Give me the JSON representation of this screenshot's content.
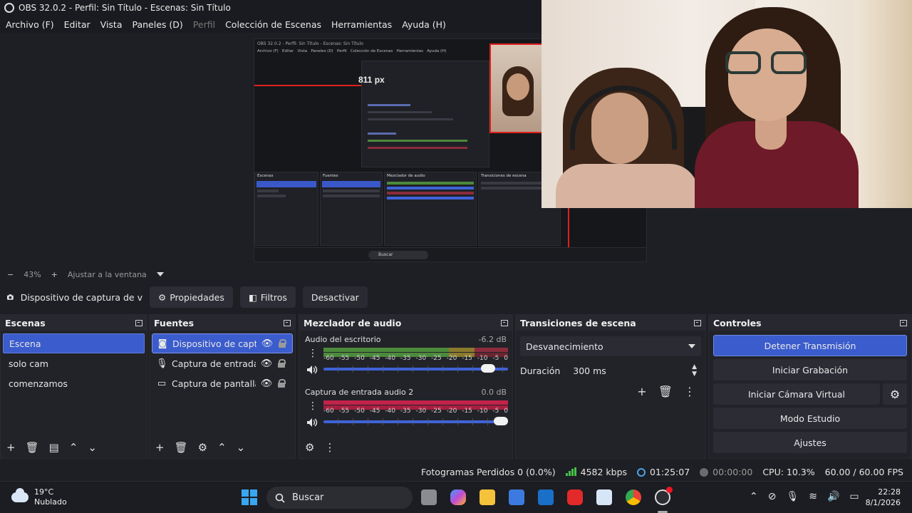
{
  "window": {
    "title": "OBS 32.0.2 - Perfil: Sin Título - Escenas: Sin Título"
  },
  "menu": [
    "Archivo (F)",
    "Editar",
    "Vista",
    "Paneles (D)",
    "Perfil",
    "Colección de Escenas",
    "Herramientas",
    "Ayuda (H)"
  ],
  "preview": {
    "nested_measure": "811 px",
    "nested_search": "Buscar"
  },
  "zoom": {
    "minus": "−",
    "level": "43%",
    "plus": "+",
    "fit": "Ajustar a la ventana"
  },
  "context": {
    "source": "Dispositivo de captura de v",
    "properties": "Propiedades",
    "filters": "Filtros",
    "deactivate": "Desactivar"
  },
  "scenes": {
    "title": "Escenas",
    "items": [
      "Escena",
      "solo cam",
      "comenzamos"
    ],
    "selected": 0
  },
  "sources": {
    "title": "Fuentes",
    "items": [
      {
        "name": "Dispositivo de captur",
        "icon": "camera-icon"
      },
      {
        "name": "Captura de entrada a",
        "icon": "microphone-icon"
      },
      {
        "name": "Captura de pantalla",
        "icon": "monitor-icon"
      }
    ]
  },
  "mixer": {
    "title": "Mezclador de audio",
    "ticks": [
      "-60",
      "-55",
      "-50",
      "-45",
      "-40",
      "-35",
      "-30",
      "-25",
      "-20",
      "-15",
      "-10",
      "-5",
      "0"
    ],
    "channels": [
      {
        "name": "Audio del escritorio",
        "db": "-6.2 dB",
        "volume": 0.93
      },
      {
        "name": "Captura de entrada audio 2",
        "db": "0.0 dB",
        "volume": 1.0
      }
    ]
  },
  "transitions": {
    "title": "Transiciones de escena",
    "selected": "Desvanecimiento",
    "duration_label": "Duración",
    "duration_value": "300 ms"
  },
  "controls": {
    "title": "Controles",
    "stop_stream": "Detener Transmisión",
    "start_recording": "Iniciar Grabación",
    "virtual_cam": "Iniciar Cámara Virtual",
    "studio_mode": "Modo Estudio",
    "settings": "Ajustes"
  },
  "status": {
    "dropped": "Fotogramas Perdidos 0 (0.0%)",
    "bitrate": "4582 kbps",
    "stream_time": "01:25:07",
    "rec_time": "00:00:00",
    "cpu": "CPU: 10.3%",
    "fps": "60.00 / 60.00 FPS"
  },
  "taskbar": {
    "temp": "19°C",
    "weather": "Nublado",
    "search": "Buscar",
    "time": "22:28",
    "date": "8/1/2026"
  },
  "colors": {
    "accent": "#3b5ccc",
    "meter_green": "#4caf50",
    "meter_red": "#c2234a",
    "stream_ok": "#45c247"
  }
}
